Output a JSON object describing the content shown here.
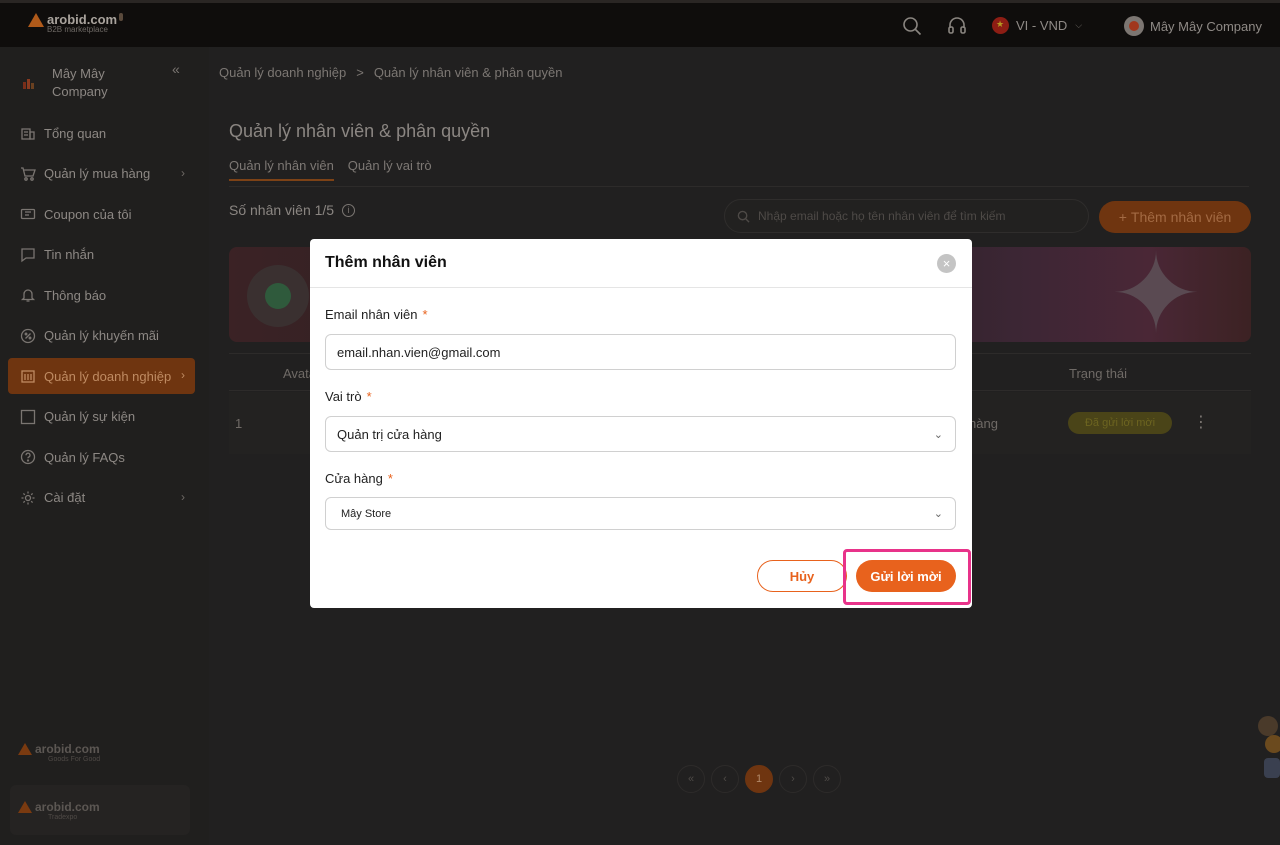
{
  "topbar": {
    "logo_text": "arobid.com",
    "logo_sub": "B2B marketplace",
    "language": "VI - VND",
    "user_name": "Mây Mây Company"
  },
  "sidebar": {
    "company_name": "Mây Mây Company",
    "items": [
      {
        "label": "Tổng quan",
        "icon": "building-icon"
      },
      {
        "label": "Quản lý mua hàng",
        "icon": "cart-icon",
        "has_arrow": true
      },
      {
        "label": "Coupon của tôi",
        "icon": "coupon-icon"
      },
      {
        "label": "Tin nhắn",
        "icon": "message-icon"
      },
      {
        "label": "Thông báo",
        "icon": "bell-icon"
      },
      {
        "label": "Quản lý khuyến mãi",
        "icon": "discount-icon"
      },
      {
        "label": "Quản lý doanh nghiệp",
        "icon": "enterprise-icon",
        "has_arrow": true,
        "active": true
      },
      {
        "label": "Quản lý sự kiện",
        "icon": "event-icon"
      },
      {
        "label": "Quản lý FAQs",
        "icon": "faq-icon"
      },
      {
        "label": "Cài đặt",
        "icon": "gear-icon",
        "has_arrow": true
      }
    ],
    "promos": [
      {
        "brand": "arobid.com",
        "tag": "Goods For Good"
      },
      {
        "brand": "arobid.com",
        "tag": "Tradexpo"
      }
    ]
  },
  "main": {
    "breadcrumb": [
      "Quản lý doanh nghiệp",
      "Quản lý nhân viên & phân quyền"
    ],
    "breadcrumb_separator": ">",
    "title": "Quản lý nhân viên & phân quyền",
    "tabs": [
      "Quản lý nhân viên",
      "Quản lý vai trò"
    ],
    "count_label": "Số nhân viên 1/5",
    "search_placeholder": "Nhập email hoặc họ tên nhân viên để tìm kiếm",
    "add_button": "Thêm nhân viên",
    "table": {
      "headers": [
        "Avatar",
        "Trạng thái"
      ],
      "rows": [
        {
          "index": "1",
          "role": "hàng",
          "status": "Đã gửi lời mời"
        }
      ]
    },
    "pagination": {
      "current": "1"
    }
  },
  "modal": {
    "title": "Thêm nhân viên",
    "email_label": "Email nhân viên",
    "email_value": "email.nhan.vien@gmail.com",
    "role_label": "Vai trò",
    "role_value": "Quản trị cửa hàng",
    "store_label": "Cửa hàng",
    "store_value": "Mây Store",
    "required_mark": "*",
    "cancel_label": "Hủy",
    "send_label": "Gửi lời mời"
  },
  "colors": {
    "accent": "#e8621d",
    "highlight": "#e8338a"
  }
}
